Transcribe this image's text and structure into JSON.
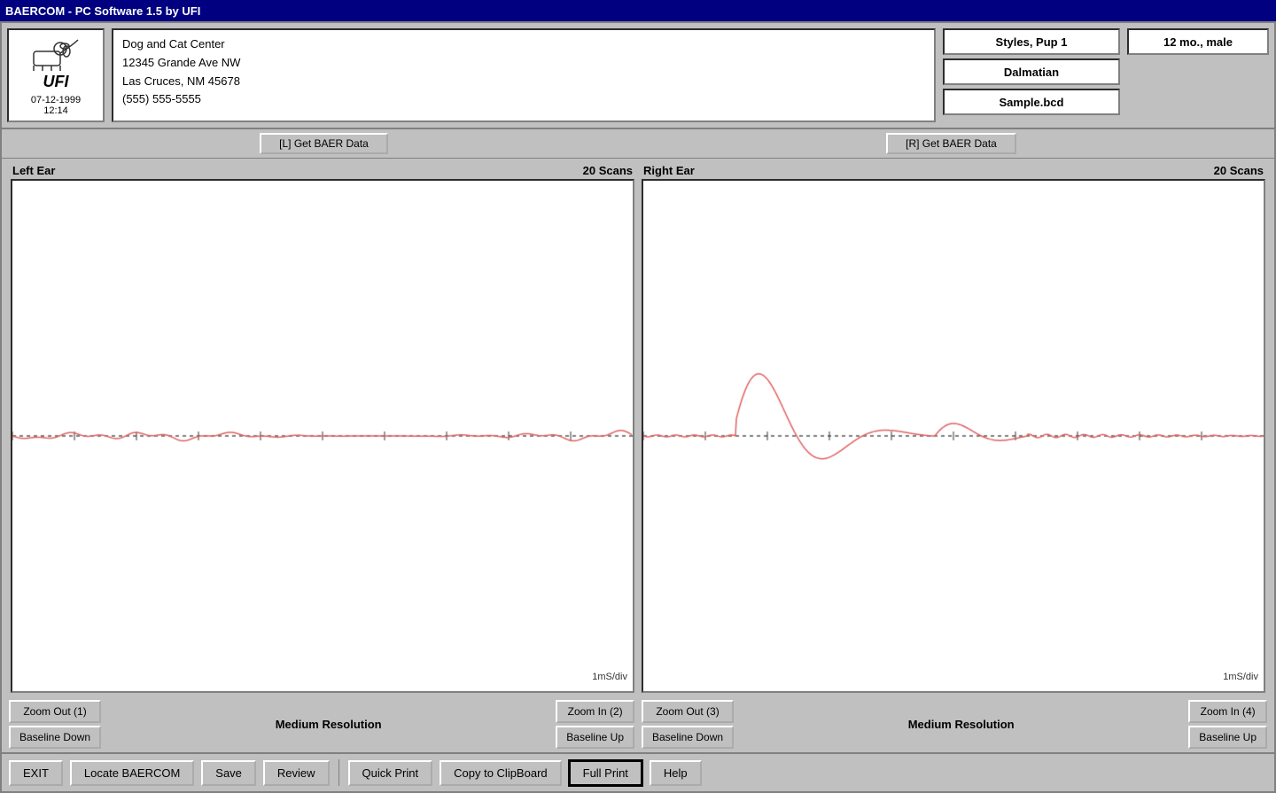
{
  "titleBar": {
    "text": "BAERCOM - PC Software 1.5  by UFI"
  },
  "header": {
    "logo": {
      "name": "UFI",
      "date": "07-12-1999",
      "time": "12:14"
    },
    "clinic": {
      "name": "Dog and Cat Center",
      "address1": "12345 Grande Ave NW",
      "address2": "Las Cruces, NM  45678",
      "phone": "(555) 555-5555"
    },
    "patient": {
      "name": "Styles, Pup 1",
      "breed": "Dalmatian",
      "filename": "Sample.bcd"
    },
    "patientInfo": {
      "ageGender": "12 mo., male"
    }
  },
  "dataButtons": {
    "left": "[L]  Get BAER Data",
    "right": "[R]  Get BAER Data"
  },
  "charts": {
    "left": {
      "label": "Left Ear",
      "scans": "20 Scans",
      "scale": "1mS/div"
    },
    "right": {
      "label": "Right Ear",
      "scans": "20 Scans",
      "scale": "1mS/div"
    }
  },
  "controls": {
    "left": {
      "zoomOut": "Zoom Out (1)",
      "zoomIn": "Zoom In (2)",
      "baselineDown": "Baseline Down",
      "baselineUp": "Baseline Up",
      "resolution": "Medium Resolution"
    },
    "right": {
      "zoomOut": "Zoom Out (3)",
      "zoomIn": "Zoom In (4)",
      "baselineDown": "Baseline Down",
      "baselineUp": "Baseline Up",
      "resolution": "Medium Resolution"
    }
  },
  "bottomBar": {
    "exit": "EXIT",
    "locateBAERCOM": "Locate BAERCOM",
    "save": "Save",
    "review": "Review",
    "quickPrint": "Quick Print",
    "copyToClipboard": "Copy to ClipBoard",
    "fullPrint": "Full Print",
    "help": "Help"
  }
}
